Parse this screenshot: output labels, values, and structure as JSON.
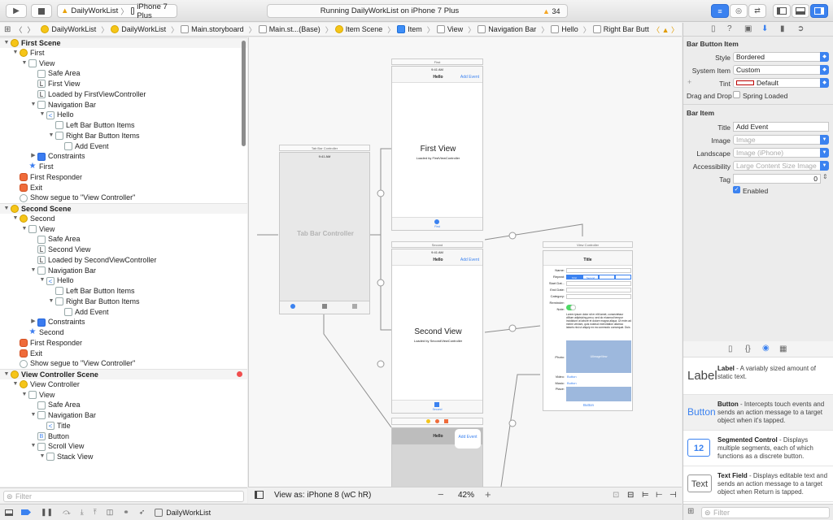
{
  "toolbar": {
    "scheme": "DailyWorkList",
    "device": "iPhone 7 Plus",
    "status": "Running DailyWorkList on iPhone 7 Plus",
    "warnings": "34",
    "colors": {
      "accent": "#3b82f0",
      "warning": "#f5a623"
    }
  },
  "jumpbar": [
    "DailyWorkList",
    "DailyWorkList",
    "Main.storyboard",
    "Main.st...(Base)",
    "Item Scene",
    "Item",
    "View",
    "Navigation Bar",
    "Hello",
    "Right Bar Button Items",
    "Add Event"
  ],
  "outline": [
    {
      "t": "First Scene",
      "d": 0,
      "k": "scene",
      "i": "y"
    },
    {
      "t": "First",
      "d": 1,
      "k": "open",
      "i": "y"
    },
    {
      "t": "View",
      "d": 2,
      "k": "open",
      "i": "v"
    },
    {
      "t": "Safe Area",
      "d": 3,
      "i": "v"
    },
    {
      "t": "First View",
      "d": 3,
      "i": "L"
    },
    {
      "t": "Loaded by FirstViewController",
      "d": 3,
      "i": "L"
    },
    {
      "t": "Navigation Bar",
      "d": 3,
      "k": "open",
      "i": "v"
    },
    {
      "t": "Hello",
      "d": 4,
      "k": "open",
      "i": "<"
    },
    {
      "t": "Left Bar Button Items",
      "d": 5,
      "i": "v"
    },
    {
      "t": "Right Bar Button Items",
      "d": 5,
      "k": "open",
      "i": "v"
    },
    {
      "t": "Add Event",
      "d": 6,
      "i": "v"
    },
    {
      "t": "Constraints",
      "d": 3,
      "k": "closed",
      "i": "bl"
    },
    {
      "t": "First",
      "d": 2,
      "i": "st"
    },
    {
      "t": "First Responder",
      "d": 1,
      "i": "or"
    },
    {
      "t": "Exit",
      "d": 1,
      "i": "or"
    },
    {
      "t": "Show segue to \"View Controller\"",
      "d": 1,
      "i": "c"
    },
    {
      "t": "Second Scene",
      "d": 0,
      "k": "scene",
      "i": "y"
    },
    {
      "t": "Second",
      "d": 1,
      "k": "open",
      "i": "y"
    },
    {
      "t": "View",
      "d": 2,
      "k": "open",
      "i": "v"
    },
    {
      "t": "Safe Area",
      "d": 3,
      "i": "v"
    },
    {
      "t": "Second View",
      "d": 3,
      "i": "L"
    },
    {
      "t": "Loaded by SecondViewController",
      "d": 3,
      "i": "L"
    },
    {
      "t": "Navigation Bar",
      "d": 3,
      "k": "open",
      "i": "v"
    },
    {
      "t": "Hello",
      "d": 4,
      "k": "open",
      "i": "<"
    },
    {
      "t": "Left Bar Button Items",
      "d": 5,
      "i": "v"
    },
    {
      "t": "Right Bar Button Items",
      "d": 5,
      "k": "open",
      "i": "v"
    },
    {
      "t": "Add Event",
      "d": 6,
      "i": "v"
    },
    {
      "t": "Constraints",
      "d": 3,
      "k": "closed",
      "i": "bl"
    },
    {
      "t": "Second",
      "d": 2,
      "i": "st"
    },
    {
      "t": "First Responder",
      "d": 1,
      "i": "or"
    },
    {
      "t": "Exit",
      "d": 1,
      "i": "or"
    },
    {
      "t": "Show segue to \"View Controller\"",
      "d": 1,
      "i": "c"
    },
    {
      "t": "View Controller Scene",
      "d": 0,
      "k": "scene",
      "i": "y"
    },
    {
      "t": "View Controller",
      "d": 1,
      "k": "open",
      "i": "y"
    },
    {
      "t": "View",
      "d": 2,
      "k": "open",
      "i": "v"
    },
    {
      "t": "Safe Area",
      "d": 3,
      "i": "v"
    },
    {
      "t": "Navigation Bar",
      "d": 3,
      "k": "open",
      "i": "v"
    },
    {
      "t": "Title",
      "d": 4,
      "i": "<"
    },
    {
      "t": "Button",
      "d": 3,
      "i": "B"
    },
    {
      "t": "Scroll View",
      "d": 3,
      "k": "open",
      "i": "v"
    },
    {
      "t": "Stack View",
      "d": 4,
      "k": "open",
      "i": "v"
    }
  ],
  "nav_filter": "Filter",
  "canvas": {
    "view_as": "View as: iPhone 8 (wC hR)",
    "zoom": "42%",
    "tab_bar_controller": {
      "title": "Tab Bar Controller",
      "label": "Tab Bar Controller",
      "time": "9:41 AM"
    },
    "first": {
      "title": "First",
      "time": "9:41 AM",
      "nav": "Hello",
      "add": "Add Event",
      "heading": "First View",
      "sub": "Loaded by FirstViewController",
      "tab": "First"
    },
    "second": {
      "title": "Second",
      "time": "9:41 AM",
      "nav": "Hello",
      "add": "Add Event",
      "heading": "Second View",
      "sub": "Loaded by SecondViewController",
      "tab": "Second"
    },
    "item": {
      "nav": "Hello",
      "add": "Add Event"
    },
    "vc": {
      "title": "View Controller",
      "nav": "Title",
      "fields": [
        "Name:",
        "Repeat:",
        "Start Dat...",
        "End Date:",
        "Category:",
        "Reminder:",
        "Note:"
      ],
      "segments": [
        "First",
        "Second",
        "",
        ""
      ],
      "note": "Lorem ipsum dolor sit er elit lamet, consectetaur cillium adipisicing pecu, sed do eiusmod tempor incididunt ut labore et dolore magna aliqua. Ut enim ad minim veniam, quis nostrud exercitation ullamco laboris nisi ut aliquip ex ea commodo consequat. Duis",
      "photo": "Photo:",
      "video": "Video:",
      "music": "Music:",
      "place": "Place:",
      "button": "Button",
      "image_label": "UIImageView"
    }
  },
  "inspector": {
    "section1": "Bar Button Item",
    "style_label": "Style",
    "style": "Bordered",
    "system_label": "System Item",
    "system": "Custom",
    "tint_label": "Tint",
    "tint": "Default",
    "drag_label": "Drag and Drop",
    "spring": "Spring Loaded",
    "section2": "Bar Item",
    "title_label": "Title",
    "title": "Add Event",
    "image_label": "Image",
    "image_ph": "Image",
    "landscape_label": "Landscape",
    "landscape_ph": "Image (iPhone)",
    "access_label": "Accessibility",
    "access_ph": "Large Content Size Image",
    "tag_label": "Tag",
    "tag": "0",
    "enabled": "Enabled"
  },
  "library": [
    {
      "icon": "Label",
      "name": "Label",
      "desc": " - A variably sized amount of static text."
    },
    {
      "icon": "Button",
      "name": "Button",
      "desc": " - Intercepts touch events and sends an action message to a target object when it's tapped."
    },
    {
      "icon": "12",
      "name": "Segmented Control",
      "desc": " - Displays multiple segments, each of which functions as a discrete button."
    },
    {
      "icon": "Text",
      "name": "Text Field",
      "desc": " - Displays editable text and sends an action message to a target object when Return is tapped."
    }
  ],
  "lib_filter": "Filter",
  "bottom": {
    "app": "DailyWorkList"
  }
}
